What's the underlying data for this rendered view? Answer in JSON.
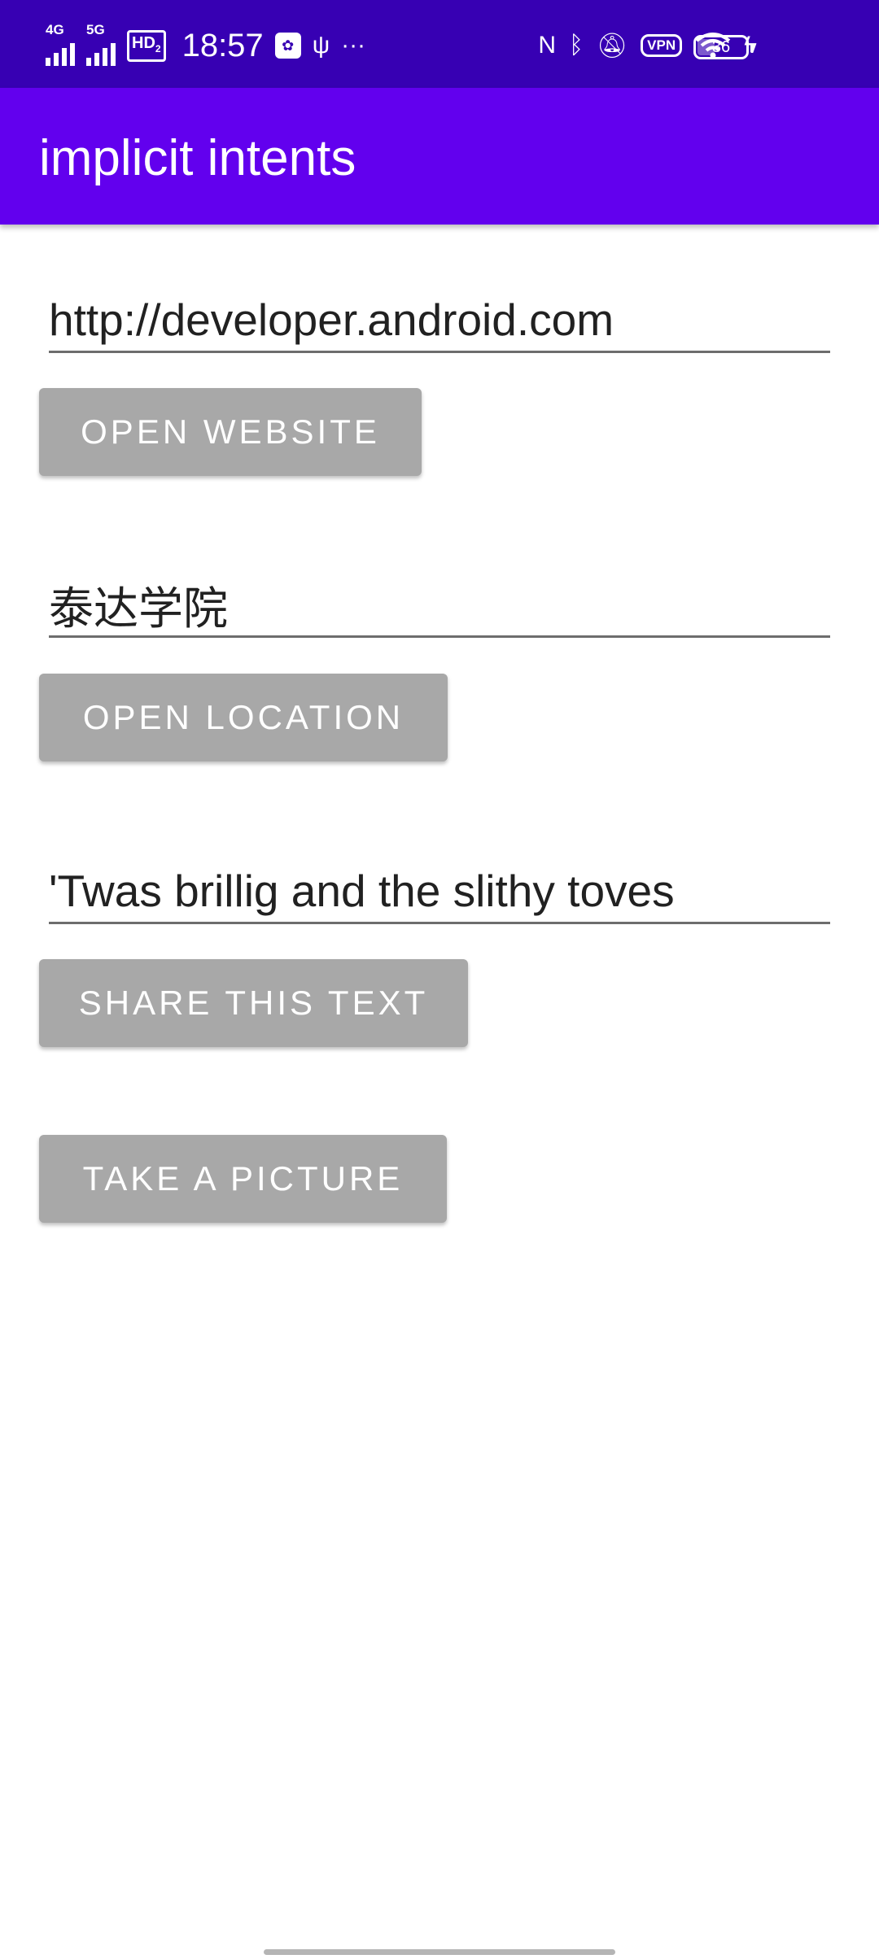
{
  "status_bar": {
    "signal1_label": "4G",
    "signal2_label": "5G",
    "hd_label": "HD",
    "hd_sub": "2",
    "time": "18:57",
    "battery_level": "36",
    "vpn_label": "VPN",
    "icons": [
      "signal-4g-icon",
      "signal-5g-icon",
      "hd-voice-icon",
      "app-notification-icon",
      "usb-icon",
      "more-icon",
      "nfc-icon",
      "bluetooth-icon",
      "mute-icon",
      "vpn-icon",
      "wifi-icon",
      "charging-icon",
      "battery-icon"
    ],
    "background": "#3700b3"
  },
  "app_bar": {
    "title": "implicit intents",
    "background": "#6200ee"
  },
  "website": {
    "url_value": "http://developer.android.com",
    "button_label": "OPEN WEBSITE"
  },
  "location": {
    "location_value": "泰达学院",
    "button_label": "OPEN LOCATION"
  },
  "share": {
    "text_value": "'Twas brillig and the slithy toves",
    "button_label": "SHARE THIS TEXT"
  },
  "camera": {
    "button_label": "TAKE A PICTURE"
  },
  "colors": {
    "button_bg": "#a8a8a8",
    "underline": "#6d6d6d"
  }
}
